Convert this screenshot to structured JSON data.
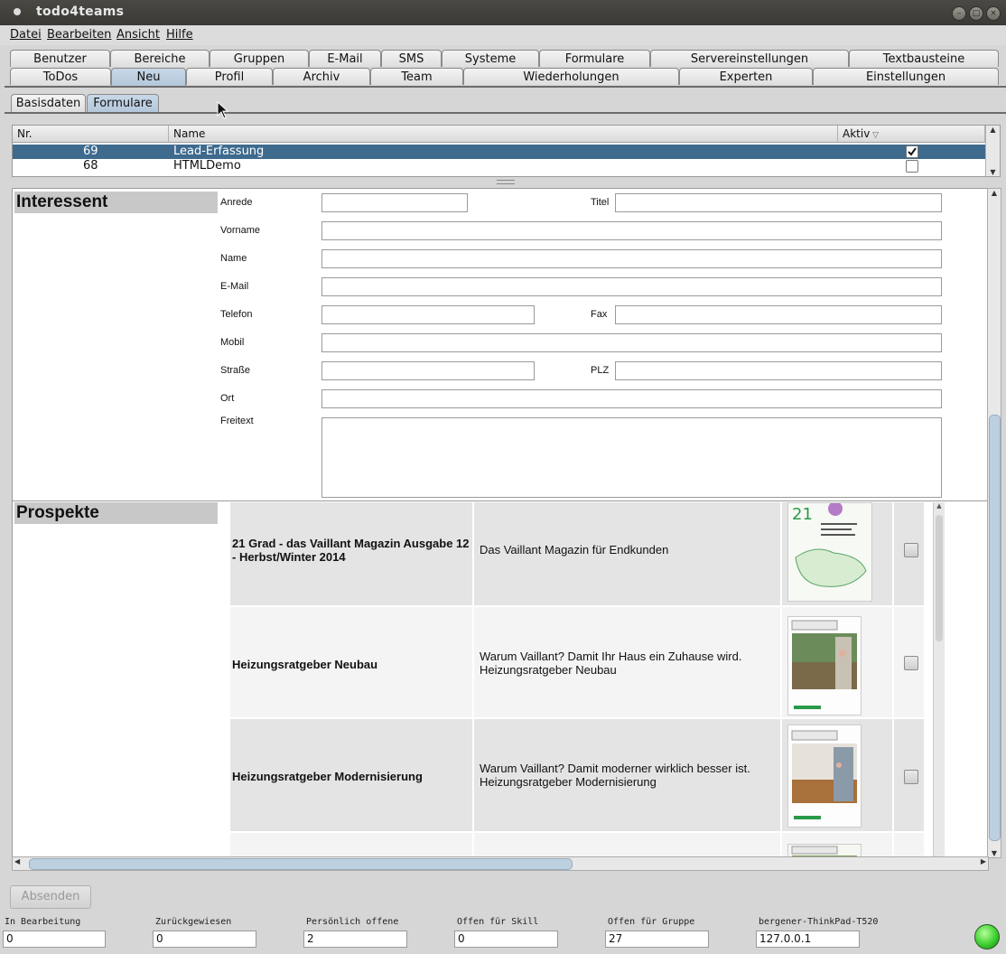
{
  "window": {
    "title": "todo4teams"
  },
  "menu": {
    "items": [
      "Datei",
      "Bearbeiten",
      "Ansicht",
      "Hilfe"
    ]
  },
  "tabs_row1": [
    "Benutzer",
    "Bereiche",
    "Gruppen",
    "E-Mail",
    "SMS",
    "Systeme",
    "Formulare",
    "Servereinstellungen",
    "Textbausteine"
  ],
  "tabs_row2": [
    "ToDos",
    "Neu",
    "Profil",
    "Archiv",
    "Team",
    "Wiederholungen",
    "Experten",
    "Einstellungen"
  ],
  "tabs_row2_selected": "Neu",
  "subtabs": [
    "Basisdaten",
    "Formulare"
  ],
  "subtabs_selected": "Formulare",
  "table": {
    "headers": {
      "nr": "Nr.",
      "name": "Name",
      "aktiv": "Aktiv"
    },
    "rows": [
      {
        "nr": "69",
        "name": "Lead-Erfassung",
        "aktiv": true,
        "selected": true
      },
      {
        "nr": "68",
        "name": "HTMLDemo",
        "aktiv": false,
        "selected": false
      }
    ]
  },
  "interessent": {
    "title": "Interessent",
    "labels": {
      "anrede": "Anrede",
      "titel": "Titel",
      "vorname": "Vorname",
      "name": "Name",
      "email": "E-Mail",
      "telefon": "Telefon",
      "fax": "Fax",
      "mobil": "Mobil",
      "strasse": "Straße",
      "plz": "PLZ",
      "ort": "Ort",
      "freitext": "Freitext"
    }
  },
  "prospekte": {
    "title": "Prospekte",
    "items": [
      {
        "title": "21 Grad - das Vaillant Magazin Ausgabe 12 - Herbst/Winter 2014",
        "desc": "Das Vaillant Magazin für Endkunden",
        "checked": false
      },
      {
        "title": "Heizungsratgeber Neubau",
        "desc": "Warum Vaillant? Damit Ihr Haus ein Zuhause wird. Heizungsratgeber Neubau",
        "checked": false
      },
      {
        "title": "Heizungsratgeber Modernisierung",
        "desc": "Warum Vaillant? Damit moderner wirklich besser ist. Heizungsratgeber Modernisierung",
        "checked": false
      }
    ]
  },
  "submit_label": "Absenden",
  "status": {
    "fields": [
      {
        "label": "In Bearbeitung",
        "value": "0"
      },
      {
        "label": "Zurückgewiesen",
        "value": "0"
      },
      {
        "label": "Persönlich offene",
        "value": "2"
      },
      {
        "label": "Offen für Skill",
        "value": "0"
      },
      {
        "label": "Offen für Gruppe",
        "value": "27"
      },
      {
        "label": "bergener-ThinkPad-T520",
        "value": "127.0.0.1"
      }
    ],
    "indicator_color": "#3ccf2e"
  },
  "colors": {
    "selection": "#3e6a8e",
    "tab_selected": "#b4c6da"
  }
}
